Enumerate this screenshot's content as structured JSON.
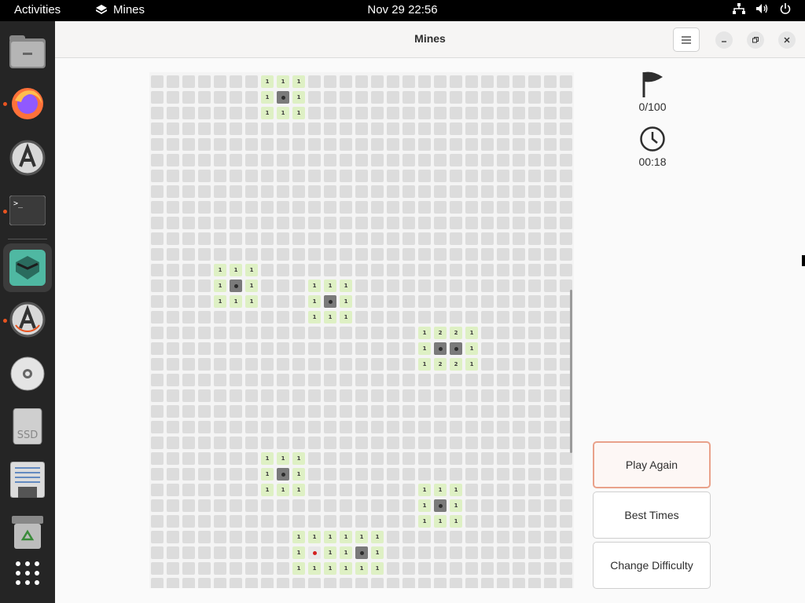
{
  "topbar": {
    "activities": "Activities",
    "app_name": "Mines",
    "clock": "Nov 29  22:56",
    "icons": [
      "network-icon",
      "volume-icon",
      "power-icon"
    ]
  },
  "dock": {
    "items": [
      "files",
      "firefox",
      "software-updater",
      "terminal",
      "mines",
      "software",
      "dvd",
      "ssd",
      "text-editor",
      "trash",
      "show-apps"
    ],
    "dock_ssd_label": "SSD"
  },
  "window": {
    "title": "Mines"
  },
  "stats": {
    "flags": "0/100",
    "time": "00:18"
  },
  "buttons": {
    "play_again": "Play Again",
    "best_times": "Best Times",
    "change_difficulty": "Change Difficulty"
  },
  "board": {
    "cols": 27,
    "rows": 33,
    "cells": [
      {
        "r": 0,
        "c": 7,
        "v": "1"
      },
      {
        "r": 0,
        "c": 8,
        "v": "1"
      },
      {
        "r": 0,
        "c": 9,
        "v": "1"
      },
      {
        "r": 1,
        "c": 7,
        "v": "1"
      },
      {
        "r": 1,
        "c": 8,
        "v": "mine"
      },
      {
        "r": 1,
        "c": 9,
        "v": "1"
      },
      {
        "r": 2,
        "c": 7,
        "v": "1"
      },
      {
        "r": 2,
        "c": 8,
        "v": "1"
      },
      {
        "r": 2,
        "c": 9,
        "v": "1"
      },
      {
        "r": 12,
        "c": 4,
        "v": "1"
      },
      {
        "r": 12,
        "c": 5,
        "v": "1"
      },
      {
        "r": 12,
        "c": 6,
        "v": "1"
      },
      {
        "r": 13,
        "c": 4,
        "v": "1"
      },
      {
        "r": 13,
        "c": 5,
        "v": "mine"
      },
      {
        "r": 13,
        "c": 6,
        "v": "1"
      },
      {
        "r": 14,
        "c": 4,
        "v": "1"
      },
      {
        "r": 14,
        "c": 5,
        "v": "1"
      },
      {
        "r": 14,
        "c": 6,
        "v": "1"
      },
      {
        "r": 13,
        "c": 10,
        "v": "1"
      },
      {
        "r": 13,
        "c": 11,
        "v": "1"
      },
      {
        "r": 13,
        "c": 12,
        "v": "1"
      },
      {
        "r": 14,
        "c": 10,
        "v": "1"
      },
      {
        "r": 14,
        "c": 11,
        "v": "mine"
      },
      {
        "r": 14,
        "c": 12,
        "v": "1"
      },
      {
        "r": 15,
        "c": 10,
        "v": "1"
      },
      {
        "r": 15,
        "c": 11,
        "v": "1"
      },
      {
        "r": 15,
        "c": 12,
        "v": "1"
      },
      {
        "r": 16,
        "c": 17,
        "v": "1"
      },
      {
        "r": 16,
        "c": 18,
        "v": "2"
      },
      {
        "r": 16,
        "c": 19,
        "v": "2"
      },
      {
        "r": 16,
        "c": 20,
        "v": "1"
      },
      {
        "r": 17,
        "c": 17,
        "v": "1"
      },
      {
        "r": 17,
        "c": 18,
        "v": "mine"
      },
      {
        "r": 17,
        "c": 19,
        "v": "mine"
      },
      {
        "r": 17,
        "c": 20,
        "v": "1"
      },
      {
        "r": 18,
        "c": 17,
        "v": "1"
      },
      {
        "r": 18,
        "c": 18,
        "v": "2"
      },
      {
        "r": 18,
        "c": 19,
        "v": "2"
      },
      {
        "r": 18,
        "c": 20,
        "v": "1"
      },
      {
        "r": 24,
        "c": 7,
        "v": "1"
      },
      {
        "r": 24,
        "c": 8,
        "v": "1"
      },
      {
        "r": 24,
        "c": 9,
        "v": "1"
      },
      {
        "r": 25,
        "c": 7,
        "v": "1"
      },
      {
        "r": 25,
        "c": 8,
        "v": "mine"
      },
      {
        "r": 25,
        "c": 9,
        "v": "1"
      },
      {
        "r": 26,
        "c": 7,
        "v": "1"
      },
      {
        "r": 26,
        "c": 8,
        "v": "1"
      },
      {
        "r": 26,
        "c": 9,
        "v": "1"
      },
      {
        "r": 26,
        "c": 17,
        "v": "1"
      },
      {
        "r": 26,
        "c": 18,
        "v": "1"
      },
      {
        "r": 26,
        "c": 19,
        "v": "1"
      },
      {
        "r": 27,
        "c": 17,
        "v": "1"
      },
      {
        "r": 27,
        "c": 18,
        "v": "mine"
      },
      {
        "r": 27,
        "c": 19,
        "v": "1"
      },
      {
        "r": 28,
        "c": 17,
        "v": "1"
      },
      {
        "r": 28,
        "c": 18,
        "v": "1"
      },
      {
        "r": 28,
        "c": 19,
        "v": "1"
      },
      {
        "r": 29,
        "c": 9,
        "v": "1"
      },
      {
        "r": 29,
        "c": 10,
        "v": "1"
      },
      {
        "r": 29,
        "c": 11,
        "v": "1"
      },
      {
        "r": 29,
        "c": 12,
        "v": "1"
      },
      {
        "r": 29,
        "c": 13,
        "v": "1"
      },
      {
        "r": 29,
        "c": 14,
        "v": "1"
      },
      {
        "r": 30,
        "c": 9,
        "v": "1"
      },
      {
        "r": 30,
        "c": 10,
        "v": "boom"
      },
      {
        "r": 30,
        "c": 11,
        "v": "1"
      },
      {
        "r": 30,
        "c": 12,
        "v": "1"
      },
      {
        "r": 30,
        "c": 13,
        "v": "mine"
      },
      {
        "r": 30,
        "c": 14,
        "v": "1"
      },
      {
        "r": 31,
        "c": 9,
        "v": "1"
      },
      {
        "r": 31,
        "c": 10,
        "v": "1"
      },
      {
        "r": 31,
        "c": 11,
        "v": "1"
      },
      {
        "r": 31,
        "c": 12,
        "v": "1"
      },
      {
        "r": 31,
        "c": 13,
        "v": "1"
      },
      {
        "r": 31,
        "c": 14,
        "v": "1"
      }
    ]
  }
}
